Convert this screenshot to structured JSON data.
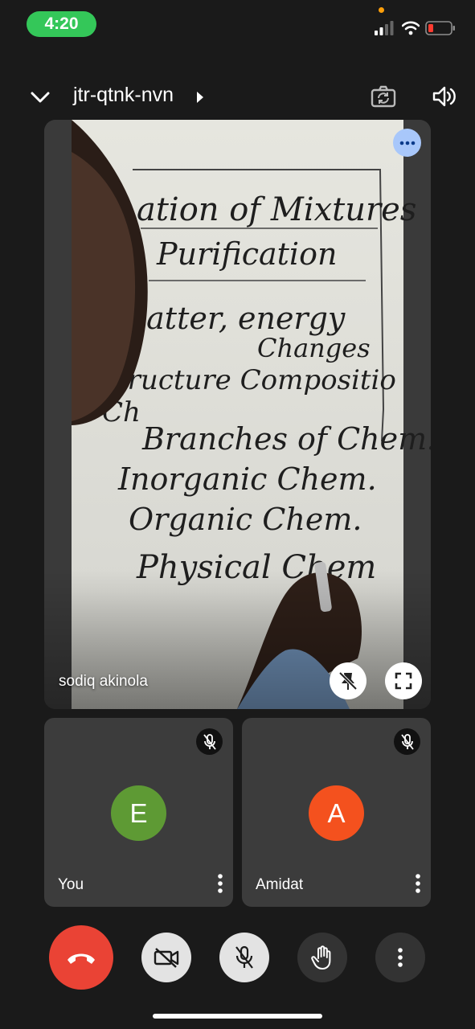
{
  "status_bar": {
    "time": "4:20"
  },
  "header": {
    "meeting_code": "jtr-qtnk-nvn"
  },
  "main_tile": {
    "participant_name": "sodiq akinola",
    "whiteboard_lines": [
      "ation of Mixtures",
      "Purification",
      "latter, energy",
      "Changes",
      "tructure Compositio",
      "Ch",
      "Branches of Chem!!",
      "Inorganic Chem.",
      "Organic Chem.",
      "Physical Chem"
    ]
  },
  "participants": [
    {
      "initial": "E",
      "name": "You",
      "avatar_color": "#5e9a34"
    },
    {
      "initial": "A",
      "name": "Amidat",
      "avatar_color": "#f4511e"
    }
  ],
  "colors": {
    "end_call": "#ea4335",
    "status_green": "#34c759",
    "more_button": "#a8c7fa"
  }
}
